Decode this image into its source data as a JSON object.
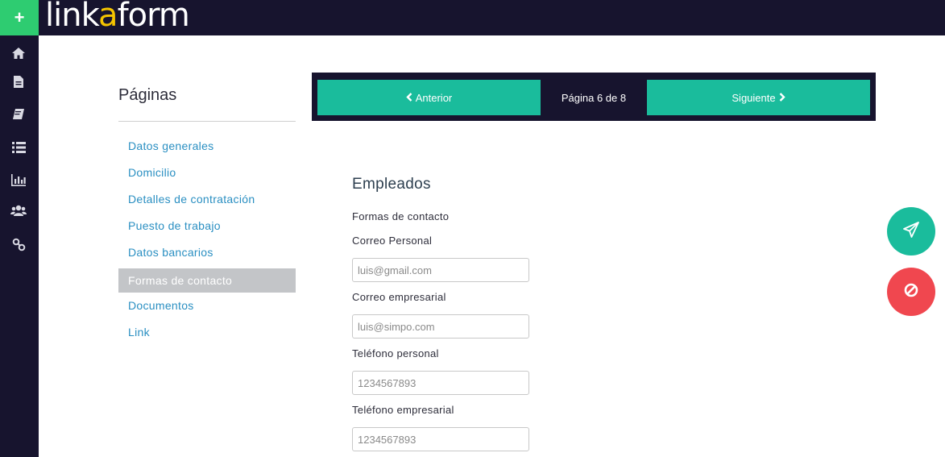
{
  "app": {
    "logo_prefix": "link",
    "logo_accent": "a",
    "logo_suffix": "form"
  },
  "rail": {
    "add_label": "+",
    "icons": [
      "home-icon",
      "document-icon",
      "book-icon",
      "list-icon",
      "chart-icon",
      "users-icon",
      "link-icon"
    ]
  },
  "sidebar": {
    "title": "Páginas",
    "items": [
      {
        "label": "Datos generales",
        "active": false
      },
      {
        "label": "Domicilio",
        "active": false
      },
      {
        "label": "Detalles de contratación",
        "active": false
      },
      {
        "label": "Puesto de trabajo",
        "active": false
      },
      {
        "label": "Datos bancarios",
        "active": false
      },
      {
        "label": "Formas de contacto",
        "active": true
      },
      {
        "label": "Documentos",
        "active": false
      },
      {
        "label": "Link",
        "active": false
      }
    ]
  },
  "pager": {
    "prev_label": "Anterior",
    "page_label": "Página 6 de 8",
    "next_label": "Siguiente"
  },
  "form": {
    "section_title": "Empleados",
    "subsection": "Formas de contacto",
    "fields": [
      {
        "label": "Correo Personal",
        "placeholder": "luis@gmail.com",
        "value": ""
      },
      {
        "label": "Correo empresarial",
        "placeholder": "luis@simpo.com",
        "value": ""
      },
      {
        "label": "Teléfono personal",
        "placeholder": "1234567893",
        "value": ""
      },
      {
        "label": "Teléfono empresarial",
        "placeholder": "1234567893",
        "value": ""
      }
    ]
  },
  "actions": {
    "send_icon": "paper-plane-icon",
    "cancel_icon": "ban-icon"
  },
  "colors": {
    "dark": "#17142e",
    "accent": "#1abc9c",
    "add": "#2ecc71",
    "danger": "#f0474f",
    "link": "#2a8fc2",
    "logo_accent": "#f5c400"
  }
}
